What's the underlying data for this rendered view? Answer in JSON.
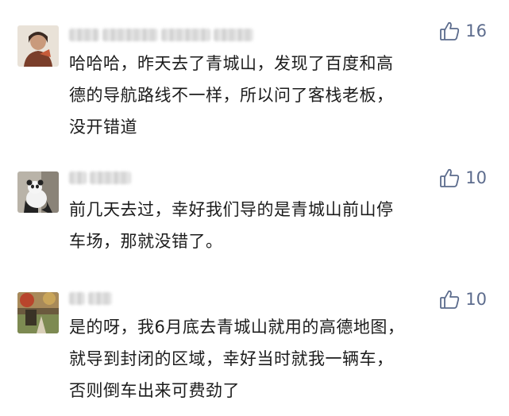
{
  "comments": [
    {
      "likes": "16",
      "text": "哈哈哈，昨天去了青城山，发现了百度和高\n德的导航路线不一样，所以问了客栈老板，\n没开错道"
    },
    {
      "likes": "10",
      "text": "前几天去过，幸好我们导的是青城山前山停\n车场，那就没错了。"
    },
    {
      "likes": "10",
      "text": "是的呀，我6月底去青城山就用的高德地图，\n就导到封闭的区域，幸好当时就我一辆车，\n否则倒车出来可费劲了"
    }
  ],
  "icons": {
    "like": "thumbs-up-icon"
  },
  "colors": {
    "like_color": "#5b6b8c",
    "text_color": "#1c1c1c"
  }
}
